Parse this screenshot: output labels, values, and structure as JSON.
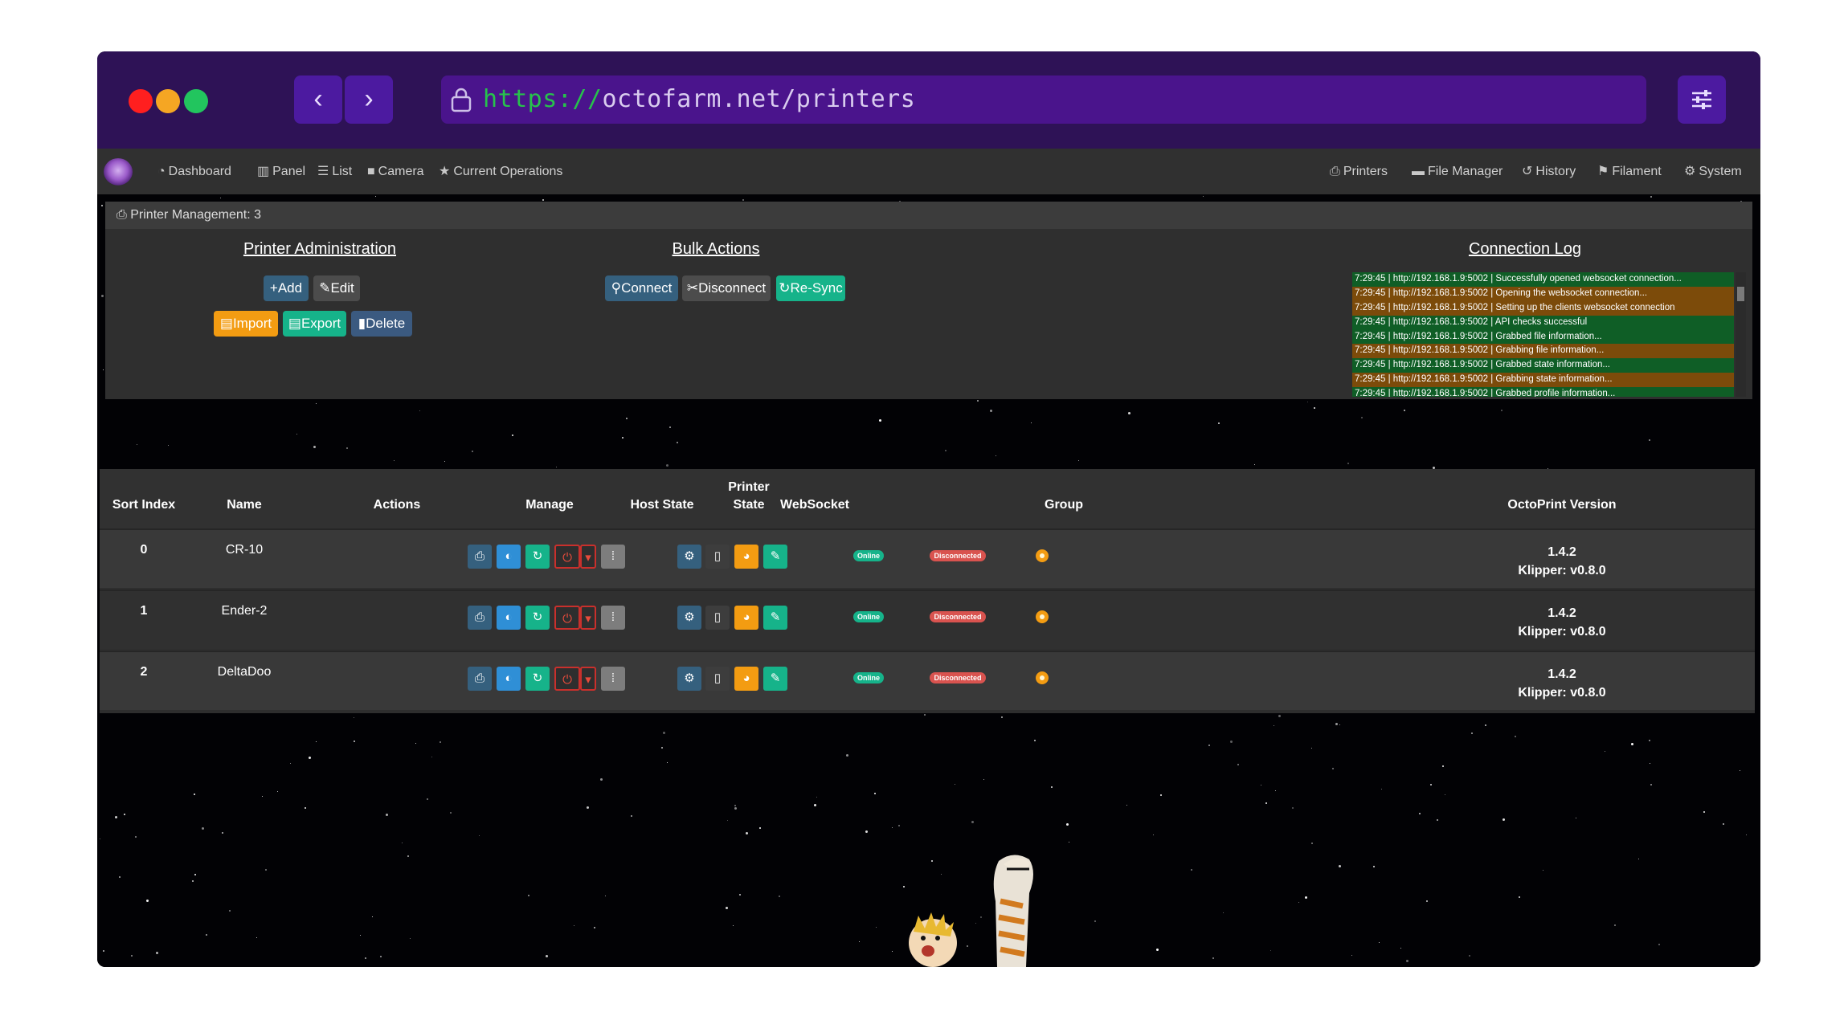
{
  "browser": {
    "url_protocol": "https://",
    "url_rest": "octofarm.net/printers",
    "back_icon": "chevron-left-icon",
    "forward_icon": "chevron-right-icon",
    "menu_icon": "sliders-icon",
    "colors": {
      "close": "#ff1f1f",
      "minimize": "#f5a623",
      "maximize": "#22c55e",
      "chrome": "#2e1256"
    }
  },
  "nav": {
    "left": [
      {
        "label": "Dashboard",
        "icon": "tachometer-icon"
      },
      {
        "label": "Panel",
        "icon": "columns-icon"
      },
      {
        "label": "List",
        "icon": "list-icon"
      },
      {
        "label": "Camera",
        "icon": "video-icon"
      },
      {
        "label": "Current Operations",
        "icon": "star-icon"
      }
    ],
    "right": [
      {
        "label": "Printers",
        "icon": "print-icon"
      },
      {
        "label": "File Manager",
        "icon": "folder-icon"
      },
      {
        "label": "History",
        "icon": "history-icon"
      },
      {
        "label": "Filament",
        "icon": "flag-icon"
      },
      {
        "label": "System",
        "icon": "cogs-icon"
      }
    ]
  },
  "management": {
    "header": "Printer Management: 3",
    "admin_title": "Printer Administration",
    "bulk_title": "Bulk Actions",
    "log_title": "Connection Log",
    "buttons": {
      "add": "Add",
      "edit": "Edit",
      "import": "Import",
      "export": "Export",
      "delete": "Delete",
      "connect": "Connect",
      "disconnect": "Disconnect",
      "resync": "Re-Sync"
    },
    "log": [
      {
        "text": "7:29:45 | http://192.168.1.9:5002 | Successfully opened websocket connection...",
        "status": "ok"
      },
      {
        "text": "7:29:45 | http://192.168.1.9:5002 | Opening the websocket connection...",
        "status": "warn"
      },
      {
        "text": "7:29:45 | http://192.168.1.9:5002 | Setting up the clients websocket connection",
        "status": "warn"
      },
      {
        "text": "7:29:45 | http://192.168.1.9:5002 | API checks successful",
        "status": "ok"
      },
      {
        "text": "7:29:45 | http://192.168.1.9:5002 | Grabbed file information...",
        "status": "ok"
      },
      {
        "text": "7:29:45 | http://192.168.1.9:5002 | Grabbing file information...",
        "status": "warn"
      },
      {
        "text": "7:29:45 | http://192.168.1.9:5002 | Grabbed state information...",
        "status": "ok"
      },
      {
        "text": "7:29:45 | http://192.168.1.9:5002 | Grabbing state information...",
        "status": "warn"
      },
      {
        "text": "7:29:45 | http://192.168.1.9:5002 | Grabbed profile information...",
        "status": "ok"
      }
    ]
  },
  "table": {
    "headers": {
      "sort_index": "Sort Index",
      "name": "Name",
      "actions": "Actions",
      "manage": "Manage",
      "host_state": "Host State",
      "printer_state_1": "Printer",
      "printer_state_2": "State",
      "websocket": "WebSocket",
      "group": "Group",
      "octoprint_version": "OctoPrint Version"
    },
    "rows": [
      {
        "index": "0",
        "name": "CR-10",
        "host_state": "Online",
        "printer_state": "Disconnected",
        "group": "",
        "version": "1.4.2",
        "klipper": "Klipper: v0.8.0"
      },
      {
        "index": "1",
        "name": "Ender-2",
        "host_state": "Online",
        "printer_state": "Disconnected",
        "group": "",
        "version": "1.4.2",
        "klipper": "Klipper: v0.8.0"
      },
      {
        "index": "2",
        "name": "DeltaDoo",
        "host_state": "Online",
        "printer_state": "Disconnected",
        "group": "",
        "version": "1.4.2",
        "klipper": "Klipper: v0.8.0"
      }
    ]
  }
}
